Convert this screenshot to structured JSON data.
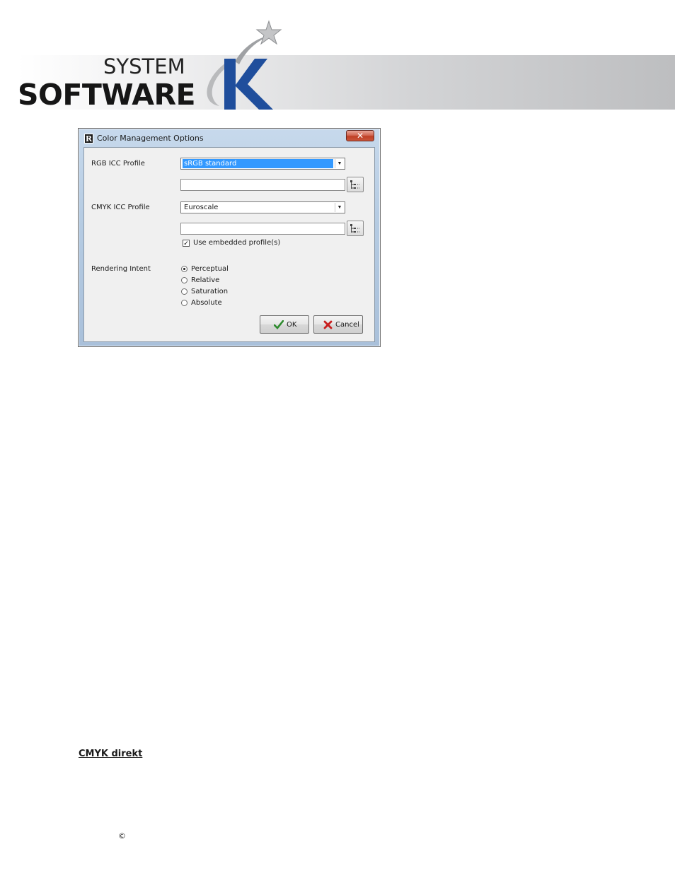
{
  "logo": {
    "line1": "SYSTEM",
    "line2": "SOFTWARE",
    "k_letter": "K",
    "brand_colors": {
      "k_blue": "#1f4e9c",
      "text_dark": "#1a1a1a"
    }
  },
  "dialog": {
    "title": "Color Management Options",
    "app_icon_letter": "R",
    "close_icon": "close-x",
    "rgb_profile_label": "RGB ICC Profile",
    "rgb_profile_value": "sRGB standard",
    "rgb_profile_path": "",
    "cmyk_profile_label": "CMYK ICC Profile",
    "cmyk_profile_value": "Euroscale",
    "cmyk_profile_path": "",
    "use_embedded_label": "Use embedded profile(s)",
    "use_embedded_checked": true,
    "rendering_intent_label": "Rendering Intent",
    "rendering_options": [
      {
        "label": "Perceptual",
        "selected": true
      },
      {
        "label": "Relative",
        "selected": false
      },
      {
        "label": "Saturation",
        "selected": false
      },
      {
        "label": "Absolute",
        "selected": false
      }
    ],
    "ok_label": "OK",
    "cancel_label": "Cancel"
  },
  "document": {
    "section_heading": "CMYK direkt",
    "copyright_symbol": "©"
  }
}
